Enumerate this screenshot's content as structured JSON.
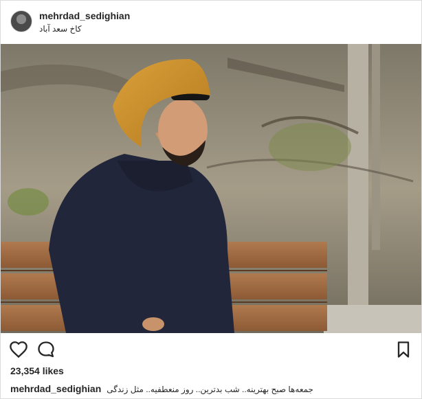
{
  "header": {
    "username": "mehrdad_sedighian",
    "location": "کاخ سعد آباد"
  },
  "photo": {
    "alt_subject": "man-in-beanie-on-bench"
  },
  "actions": {
    "like_icon": "heart-icon",
    "comment_icon": "speech-bubble-icon",
    "save_icon": "bookmark-icon"
  },
  "likes": {
    "text": "23,354 likes"
  },
  "caption": {
    "username": "mehrdad_sedighian",
    "text": "جمعه‌ها صبح بهترینه.. شب بدترین.. روز منعطفیه.. مثل زندگی"
  },
  "colors": {
    "text": "#262626",
    "border": "#dbdbdb",
    "background": "#ffffff"
  }
}
